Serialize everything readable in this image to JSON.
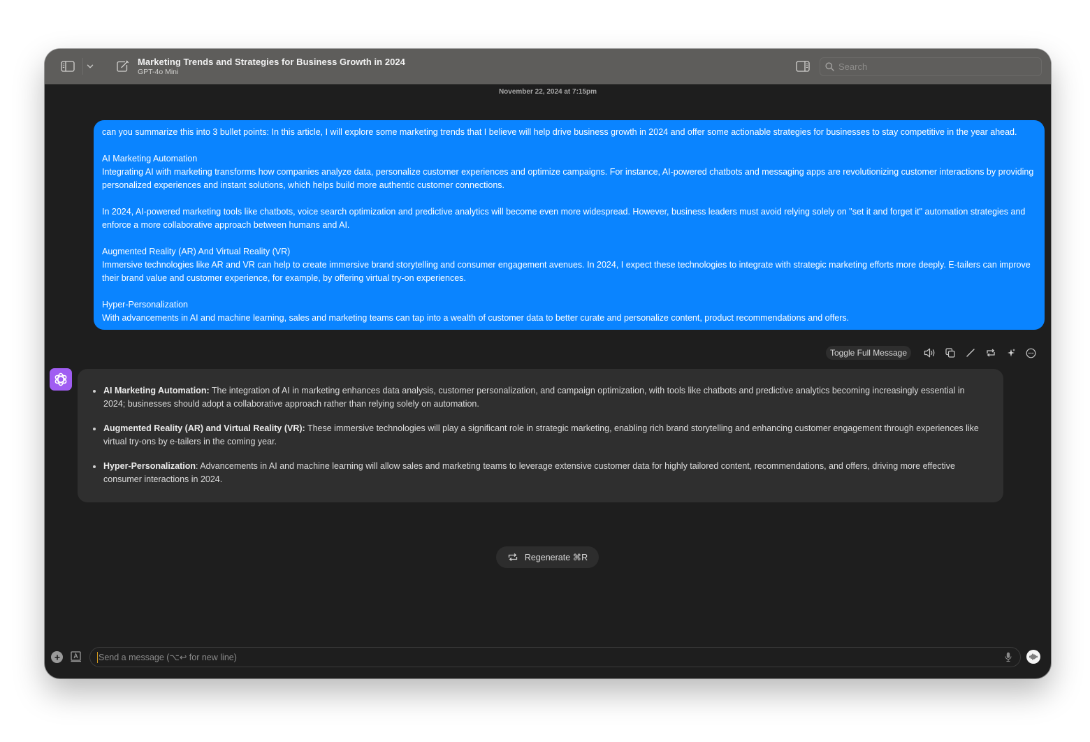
{
  "titlebar": {
    "title": "Marketing Trends and Strategies for Business Growth in 2024",
    "model": "GPT-4o Mini",
    "search_placeholder": "Search",
    "icons": [
      "sidebar-toggle-icon",
      "chevron-down-icon",
      "compose-icon",
      "inspector-toggle-icon",
      "search-icon"
    ]
  },
  "timestamp": "November 22, 2024 at 7:15pm",
  "user_message": {
    "paragraphs": [
      [
        "can you summarize this into 3 bullet points: In this article, I will explore some marketing trends that I believe will help drive business growth in 2024 and offer some actionable strategies for businesses to stay competitive in the year ahead."
      ],
      [
        "AI Marketing Automation",
        "Integrating AI with marketing transforms how companies analyze data, personalize customer experiences and optimize campaigns. For instance, AI-powered chatbots and messaging apps are revolutionizing customer interactions by providing personalized experiences and instant solutions, which helps build more authentic customer connections."
      ],
      [
        "In 2024, AI-powered marketing tools like chatbots, voice search optimization and predictive analytics will become even more widespread. However, business leaders must avoid relying solely on \"set it and forget it\" automation strategies and enforce a more collaborative approach between humans and AI."
      ],
      [
        "Augmented Reality (AR) And Virtual Reality (VR)",
        "Immersive technologies like AR and VR can help to create immersive brand storytelling and consumer engagement avenues. In 2024, I expect these technologies to integrate with strategic marketing efforts more deeply. E-tailers can improve their brand value and customer experience, for example, by offering virtual try-on experiences."
      ],
      [
        "Hyper-Personalization",
        "With advancements in AI and machine learning, sales and marketing teams can tap into a wealth of customer data to better curate and personalize content, product recommendations and offers."
      ]
    ]
  },
  "message_actions": {
    "toggle_label": "Toggle Full Message",
    "icons": [
      "speaker-icon",
      "copy-icon",
      "edit-icon",
      "retry-icon",
      "sparkle-icon",
      "more-icon"
    ]
  },
  "assistant_message": {
    "bullets": [
      {
        "bold": "AI Marketing Automation:",
        "text": " The integration of AI in marketing enhances data analysis, customer personalization, and campaign optimization, with tools like chatbots and predictive analytics becoming increasingly essential in 2024; businesses should adopt a collaborative approach rather than relying solely on automation."
      },
      {
        "bold": "Augmented Reality (AR) and Virtual Reality (VR):",
        "text": " These immersive technologies will play a significant role in strategic marketing, enabling rich brand storytelling and enhancing customer engagement through experiences like virtual try-ons by e-tailers in the coming year."
      },
      {
        "bold": "Hyper-Personalization",
        "text": ": Advancements in AI and machine learning will allow sales and marketing teams to leverage extensive customer data for highly tailored content, recommendations, and offers, driving more effective consumer interactions in 2024."
      }
    ]
  },
  "regenerate_label": "Regenerate ⌘R",
  "composer": {
    "value": "",
    "placeholder": "Send a message (⌥↩ for new line)"
  },
  "colors": {
    "user_bubble": "#0a84ff",
    "assistant_bubble": "#2f2f2f",
    "avatar": "#a05df2",
    "background": "#1e1e1e",
    "titlebar": "#5e5d5b"
  }
}
